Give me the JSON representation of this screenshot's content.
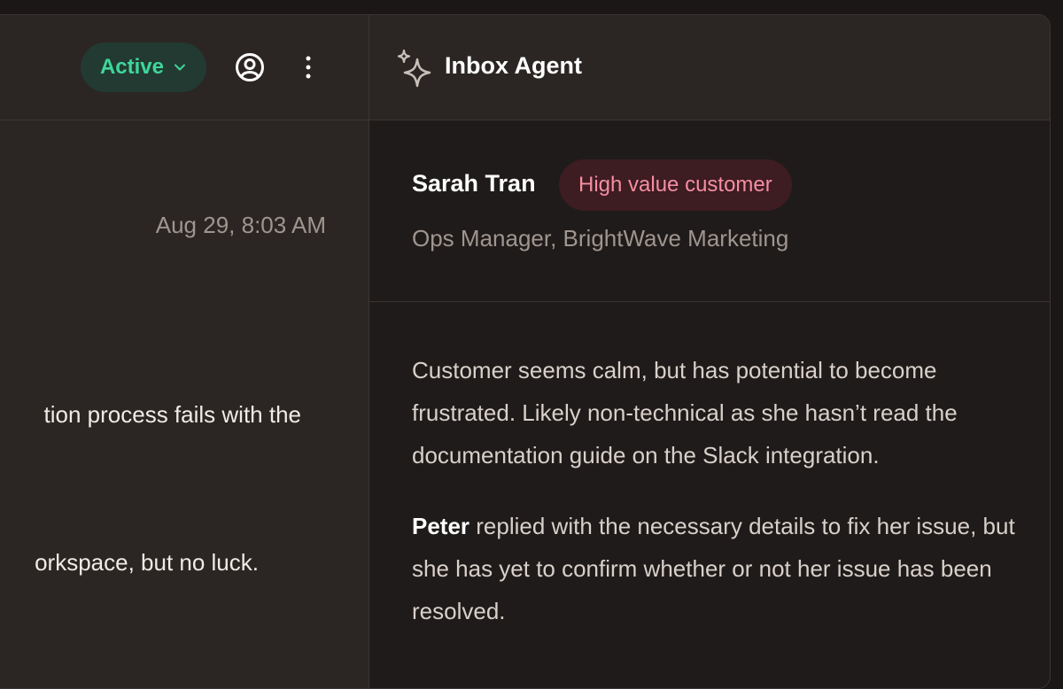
{
  "header": {
    "status": {
      "label": "Active",
      "color": "#3fd69b"
    },
    "icons": {
      "status_chevron": "chevron-down-icon",
      "user": "user-circle-icon",
      "more": "more-vertical-icon"
    }
  },
  "conversation": {
    "timestamp": "Aug 29, 8:03 AM",
    "message_fragments": [
      "tion process fails with the",
      "orkspace, but no luck."
    ]
  },
  "agent_panel": {
    "title": "Inbox Agent",
    "icon": "sparkle-icon",
    "customer": {
      "name": "Sarah Tran",
      "badge": "High value customer",
      "badge_color": "#f58ea1",
      "role": "Ops Manager, BrightWave Marketing"
    },
    "summary": {
      "paragraph1": "Customer seems calm, but has potential to become frustrated. Likely non-technical as she hasn’t read the documentation guide on the Slack integration.",
      "paragraph2_name": "Peter",
      "paragraph2_text": " replied with the necessary details to fix her issue, but she has yet to confirm whether or not her issue has been resolved."
    }
  }
}
